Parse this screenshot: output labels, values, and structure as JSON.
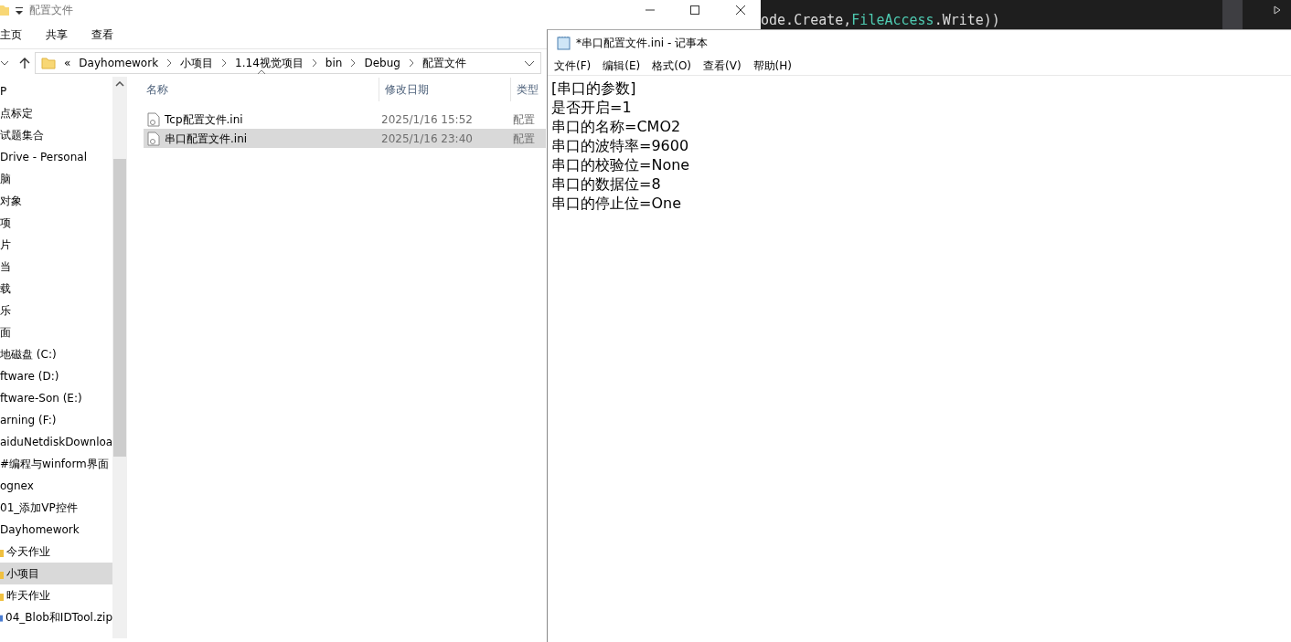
{
  "explorer": {
    "title": "配置文件",
    "ribbon_tabs": [
      {
        "label": "主页"
      },
      {
        "label": "共享"
      },
      {
        "label": "查看"
      }
    ],
    "address": {
      "overflow": "«",
      "crumbs": [
        "Dayhomework",
        "小项目",
        "1.14视觉项目",
        "bin",
        "Debug",
        "配置文件"
      ]
    },
    "nav_items": [
      {
        "label": "P",
        "selected": false,
        "kind": "text"
      },
      {
        "label": "点标定",
        "selected": false,
        "kind": "text"
      },
      {
        "label": "试题集合",
        "selected": false,
        "kind": "text"
      },
      {
        "label": "Drive - Personal",
        "selected": false,
        "kind": "text"
      },
      {
        "label": "脑",
        "selected": false,
        "kind": "text"
      },
      {
        "label": "对象",
        "selected": false,
        "kind": "text"
      },
      {
        "label": "项",
        "selected": false,
        "kind": "text"
      },
      {
        "label": "片",
        "selected": false,
        "kind": "text"
      },
      {
        "label": "当",
        "selected": false,
        "kind": "text"
      },
      {
        "label": "载",
        "selected": false,
        "kind": "text"
      },
      {
        "label": "乐",
        "selected": false,
        "kind": "text"
      },
      {
        "label": "面",
        "selected": false,
        "kind": "text"
      },
      {
        "label": "地磁盘 (C:)",
        "selected": false,
        "kind": "text"
      },
      {
        "label": "ftware (D:)",
        "selected": false,
        "kind": "text"
      },
      {
        "label": "ftware-Son (E:)",
        "selected": false,
        "kind": "text"
      },
      {
        "label": "arning (F:)",
        "selected": false,
        "kind": "text"
      },
      {
        "label": "aiduNetdiskDownloa",
        "selected": false,
        "kind": "text"
      },
      {
        "label": "#编程与winform界面",
        "selected": false,
        "kind": "text"
      },
      {
        "label": "ognex",
        "selected": false,
        "kind": "text"
      },
      {
        "label": "01_添加VP控件",
        "selected": false,
        "kind": "text"
      },
      {
        "label": "Dayhomework",
        "selected": false,
        "kind": "text"
      },
      {
        "label": "今天作业",
        "selected": false,
        "kind": "folder"
      },
      {
        "label": "小项目",
        "selected": true,
        "kind": "folder"
      },
      {
        "label": "昨天作业",
        "selected": false,
        "kind": "folder"
      },
      {
        "label": "04_Blob和IDTool.zip",
        "selected": false,
        "kind": "zip"
      }
    ],
    "columns": [
      "名称",
      "修改日期",
      "类型"
    ],
    "files": [
      {
        "name": "Tcp配置文件.ini",
        "modified": "2025/1/16 15:52",
        "type": "配置",
        "selected": false
      },
      {
        "name": "串口配置文件.ini",
        "modified": "2025/1/16 23:40",
        "type": "配置",
        "selected": true
      }
    ]
  },
  "editor": {
    "tokens": [
      {
        "text": "ode.",
        "kind": "plain"
      },
      {
        "text": "Create",
        "kind": "member"
      },
      {
        "text": ",",
        "kind": "plain"
      },
      {
        "text": "FileAccess",
        "kind": "type"
      },
      {
        "text": ".",
        "kind": "plain"
      },
      {
        "text": "Write",
        "kind": "member"
      },
      {
        "text": "))",
        "kind": "plain"
      }
    ]
  },
  "notepad": {
    "title": "*串口配置文件.ini - 记事本",
    "menu": [
      "文件(F)",
      "编辑(E)",
      "格式(O)",
      "查看(V)",
      "帮助(H)"
    ],
    "lines": [
      "[串口的参数]",
      "是否开启=1",
      "串口的名称=CMO2",
      "串口的波特率=9600",
      "串口的校验位=None",
      "串口的数据位=8",
      "串口的停止位=One"
    ]
  }
}
